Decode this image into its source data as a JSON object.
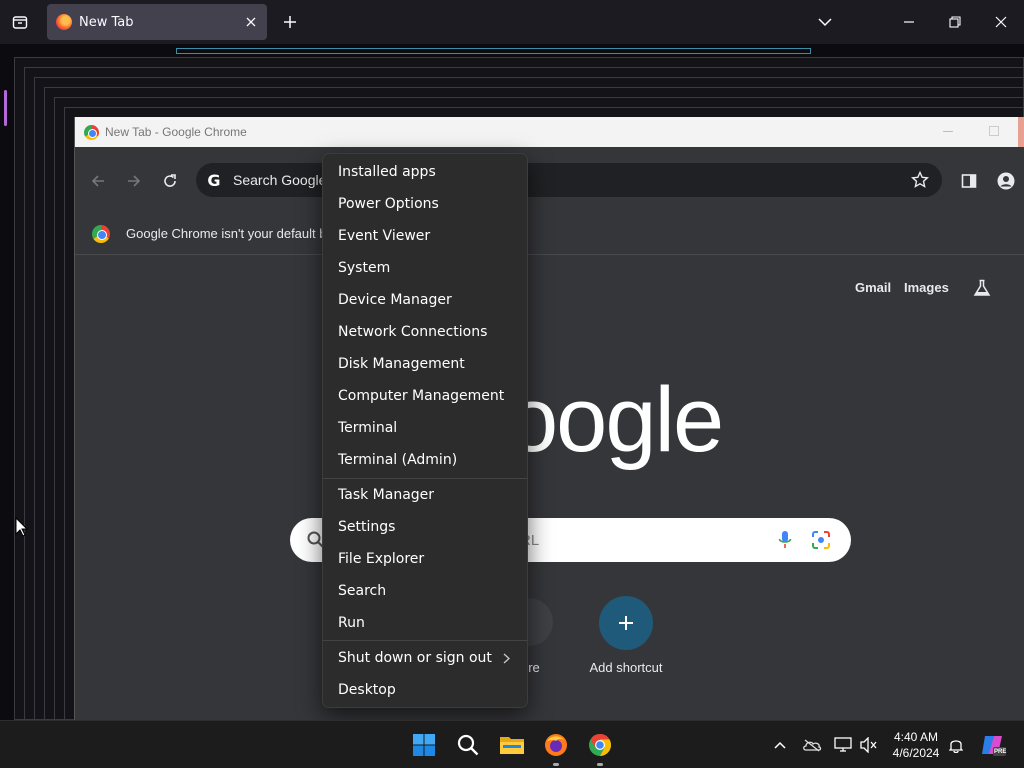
{
  "firefox": {
    "tab_title": "New Tab",
    "icons": [
      "tab-list-icon",
      "firefox-icon",
      "close-icon",
      "plus-icon",
      "chevron-down-icon",
      "minimize-icon",
      "restore-icon",
      "close-window-icon"
    ]
  },
  "chrome": {
    "window_title": "New Tab - Google Chrome",
    "omnibox_placeholder": "Search Google",
    "infobar_message": "Google Chrome isn't your default b",
    "ntp": {
      "links": [
        "Gmail",
        "Images"
      ],
      "logo_text": "oogle",
      "search_placeholder": "RL",
      "more_label": "ore",
      "add_shortcut_label": "Add shortcut"
    }
  },
  "winx_menu": {
    "group1": [
      "Installed apps",
      "Power Options",
      "Event Viewer",
      "System",
      "Device Manager",
      "Network Connections",
      "Disk Management",
      "Computer Management",
      "Terminal",
      "Terminal (Admin)"
    ],
    "group2": [
      "Task Manager",
      "Settings",
      "File Explorer",
      "Search",
      "Run"
    ],
    "group3": [
      "Shut down or sign out",
      "Desktop"
    ]
  },
  "taskbar": {
    "time": "4:40 AM",
    "date": "4/6/2024",
    "apps": [
      "start-icon",
      "search-icon",
      "file-explorer-icon",
      "firefox-icon",
      "chrome-icon"
    ],
    "tray": [
      "chevron-up-icon",
      "onedrive-icon",
      "network-icon",
      "volume-muted-icon",
      "notification-bell-icon",
      "copilot-icon"
    ],
    "copilot_badge": "PRE"
  },
  "colors": {
    "menu_bg": "#2c2c2c",
    "chrome_bg": "#35363a",
    "taskbar_bg": "#1c1c1c",
    "accent_shortcut": "#1f5a7a"
  }
}
